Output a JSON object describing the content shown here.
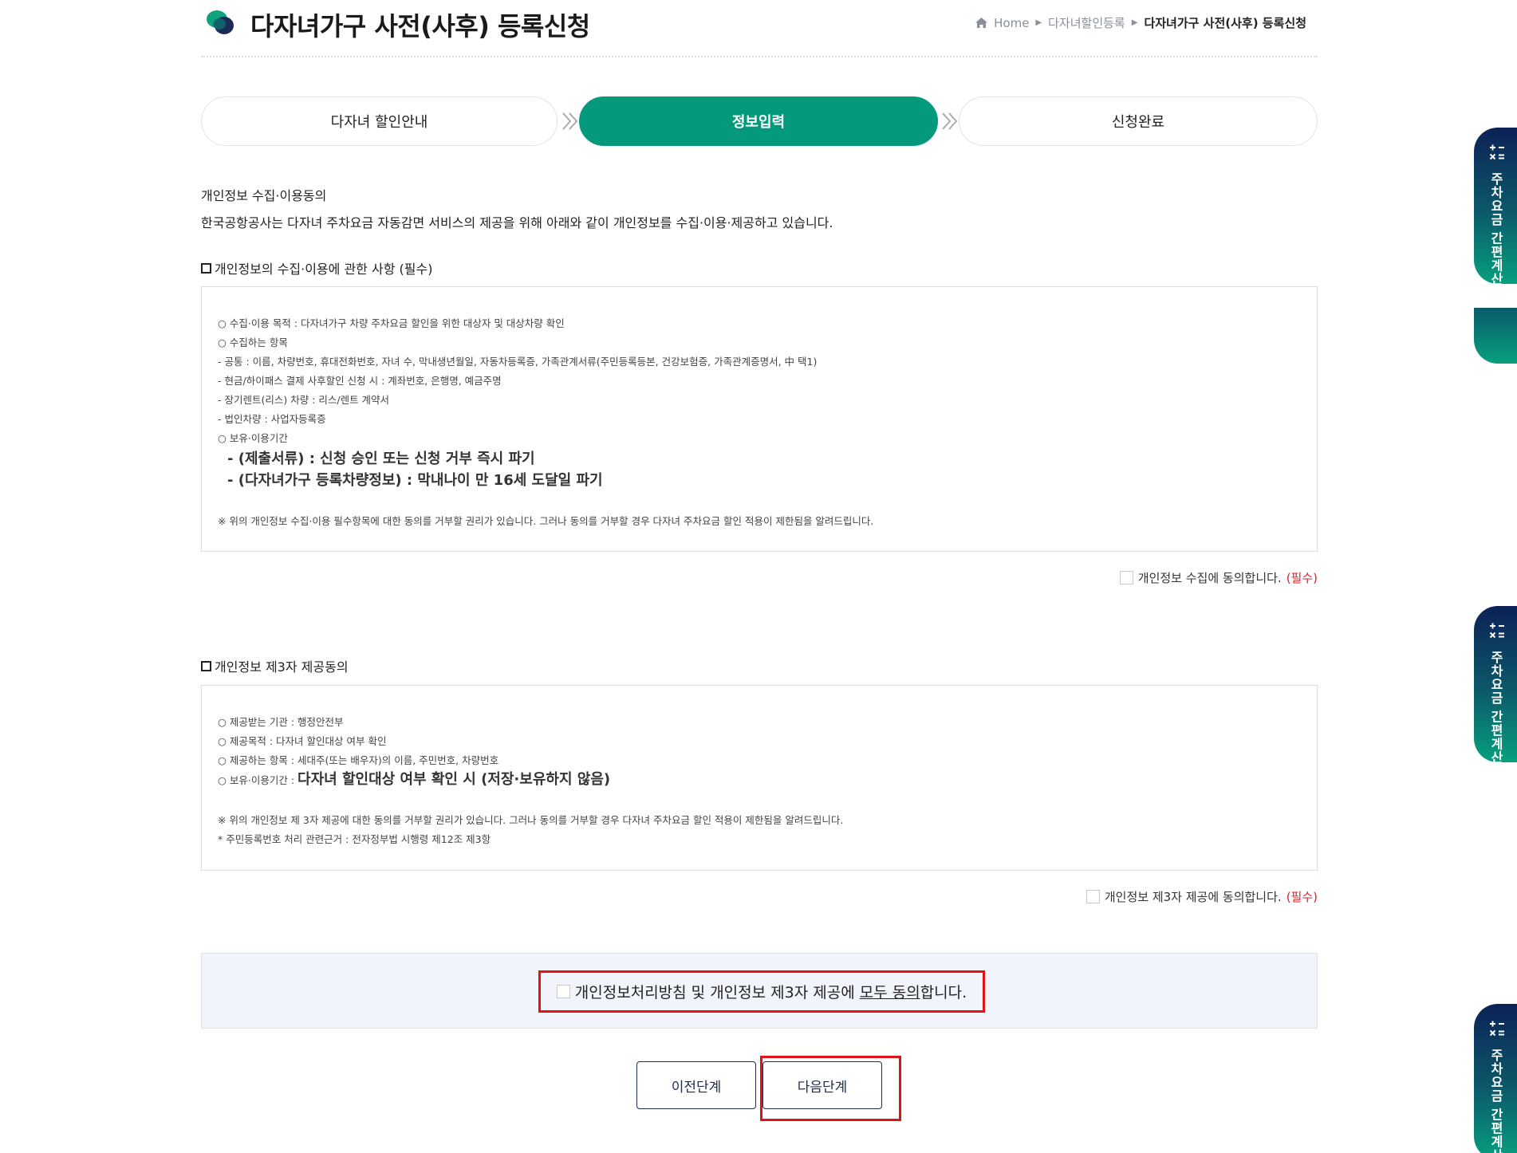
{
  "header": {
    "title": "다자녀가구 사전(사후) 등록신청",
    "breadcrumb": [
      "Home",
      "다자녀할인등록",
      "다자녀가구 사전(사후) 등록신청"
    ]
  },
  "steps": [
    "다자녀 할인안내",
    "정보입력",
    "신청완료"
  ],
  "intro": {
    "title": "개인정보 수집·이용동의",
    "text": "한국공항공사는 다자녀 주차요금 자동감면 서비스의 제공을 위해 아래와 같이 개인정보를 수집·이용·제공하고 있습니다."
  },
  "section1": {
    "heading": "개인정보의 수집·이용에 관한 사항 (필수)",
    "lines": [
      "○ 수집·이용 목적 : 다자녀가구 차량 주차요금 할인을 위한 대상자 및 대상차량 확인",
      "○ 수집하는 항목",
      " - 공통 : 이름, 차량번호, 휴대전화번호, 자녀 수, 막내생년월일, 자동차등록증, 가족관계서류(주민등록등본, 건강보험증, 가족관계증명서, 中 택1)",
      " - 현금/하이패스 결제 사후할인 신청 시 : 계좌번호, 은행명, 예금주명",
      " - 장기렌트(리스) 차량 : 리스/렌트 계약서",
      " - 법인차량 : 사업자등록증",
      "○ 보유·이용기간"
    ],
    "bold_lines": [
      "- (제출서류) : 신청 승인 또는 신청 거부 즉시 파기",
      "- (다자녀가구 등록차량정보) : 막내나이 만 16세 도달일 파기"
    ],
    "note": "※ 위의 개인정보 수집·이용 필수항목에 대한 동의를 거부할 권리가 있습니다. 그러나 동의를 거부할 경우 다자녀 주차요금 할인 적용이 제한됨을 알려드립니다.",
    "agree_label": "개인정보 수집에 동의합니다.",
    "required": "(필수)"
  },
  "section2": {
    "heading": "개인정보 제3자 제공동의",
    "lines": [
      "○ 제공받는 기관 : 행정안전부",
      "○ 제공목적 : 다자녀 할인대상 여부 확인",
      "○ 제공하는 항목 : 세대주(또는 배우자)의 이름, 주민번호, 차량번호"
    ],
    "retention_prefix": "○ 보유·이용기간 :",
    "retention_bold": "다자녀 할인대상 여부 확인 시 (저장·보유하지 않음)",
    "note": "※ 위의 개인정보 제 3자 제공에 대한 동의를 거부할 권리가 있습니다. 그러나 동의를 거부할 경우 다자녀 주차요금 할인 적용이 제한됨을 알려드립니다.",
    "note2": "* 주민등록번호 처리 관련근거 : 전자정부법 시행령 제12조 제3항",
    "agree_label": "개인정보 제3자 제공에 동의합니다.",
    "required": "(필수)"
  },
  "all_agree": {
    "prefix": "개인정보처리방침 및 개인정보 제3자 제공에 ",
    "underlined": "모두 동의",
    "suffix": "합니다."
  },
  "buttons": {
    "prev": "이전단계",
    "next": "다음단계"
  },
  "side_tab": {
    "label": "주차요금 간편계산"
  },
  "colors": {
    "accent": "#05997b",
    "navy": "#1d2b4f",
    "required": "#d9252a",
    "highlight": "#e01414"
  }
}
